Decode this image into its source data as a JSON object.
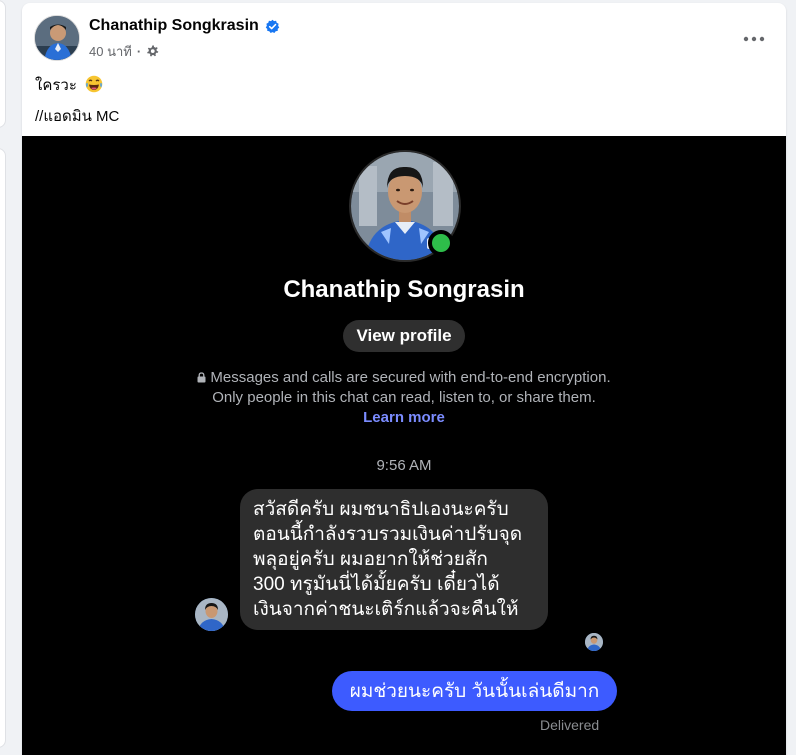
{
  "post": {
    "author_name": "Chanathip Songkrasin",
    "time_ago": "40 นาที",
    "separator": "·",
    "text_line1": "ใครวะ",
    "text_line2": "//แอดมิน MC"
  },
  "icons": {
    "verified": "verified-badge-icon",
    "audience": "gear-icon",
    "more": "more-options-icon",
    "emoji": "laughing-emoji-icon",
    "lock": "lock-icon"
  },
  "chat": {
    "contact_name": "Chanathip Songrasin",
    "view_profile_label": "View profile",
    "encryption_text": "Messages and calls are secured with end-to-end encryption. Only people in this chat can read, listen to, or share them.",
    "learn_more_label": "Learn more",
    "timestamp": "9:56 AM",
    "incoming_lines": [
      "สวัสดีครับ ผมชนาธิปเองนะครับ",
      "ตอนนี้กำลังรวบรวมเงินค่าปรับจุด",
      "พลุอยู่ครับ ผมอยากให้ช่วยสัก",
      "300 ทรูมันนี่ได้มั้ยครับ เดี๋ยวได้",
      "เงินจากค่าชนะเติร์กแล้วจะคืนให้"
    ],
    "outgoing_message": "ผมช่วยนะครับ วันนั้นเล่นดีมาก",
    "delivery_status": "Delivered"
  },
  "colors": {
    "outgoing_bubble": "#3d5bff",
    "incoming_bubble": "#2e2e2e",
    "online_dot": "#2ebd4a",
    "verified_blue": "#1877f2",
    "link": "#7b8cff"
  }
}
